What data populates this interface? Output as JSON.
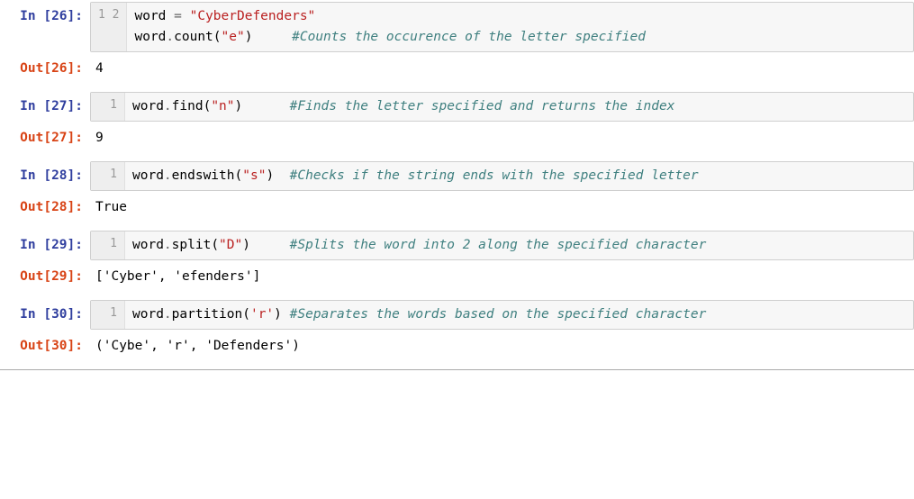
{
  "cells": [
    {
      "exec": 26,
      "lines": [
        [
          {
            "t": "var",
            "v": "word"
          },
          {
            "t": "txt",
            "v": " "
          },
          {
            "t": "op",
            "v": "="
          },
          {
            "t": "txt",
            "v": " "
          },
          {
            "t": "str",
            "v": "\"CyberDefenders\""
          }
        ],
        [
          {
            "t": "var",
            "v": "word"
          },
          {
            "t": "op",
            "v": "."
          },
          {
            "t": "call",
            "v": "count"
          },
          {
            "t": "paren",
            "v": "("
          },
          {
            "t": "str",
            "v": "\"e\""
          },
          {
            "t": "paren",
            "v": ")"
          },
          {
            "t": "txt",
            "v": "     "
          },
          {
            "t": "comment",
            "v": "#Counts the occurence of the letter specified"
          }
        ]
      ],
      "output": "4"
    },
    {
      "exec": 27,
      "lines": [
        [
          {
            "t": "var",
            "v": "word"
          },
          {
            "t": "op",
            "v": "."
          },
          {
            "t": "call",
            "v": "find"
          },
          {
            "t": "paren",
            "v": "("
          },
          {
            "t": "str",
            "v": "\"n\""
          },
          {
            "t": "paren",
            "v": ")"
          },
          {
            "t": "txt",
            "v": "      "
          },
          {
            "t": "comment",
            "v": "#Finds the letter specified and returns the index"
          }
        ]
      ],
      "output": "9"
    },
    {
      "exec": 28,
      "lines": [
        [
          {
            "t": "var",
            "v": "word"
          },
          {
            "t": "op",
            "v": "."
          },
          {
            "t": "call",
            "v": "endswith"
          },
          {
            "t": "paren",
            "v": "("
          },
          {
            "t": "str",
            "v": "\"s\""
          },
          {
            "t": "paren",
            "v": ")"
          },
          {
            "t": "txt",
            "v": "  "
          },
          {
            "t": "comment",
            "v": "#Checks if the string ends with the specified letter "
          }
        ]
      ],
      "output": "True"
    },
    {
      "exec": 29,
      "lines": [
        [
          {
            "t": "var",
            "v": "word"
          },
          {
            "t": "op",
            "v": "."
          },
          {
            "t": "call",
            "v": "split"
          },
          {
            "t": "paren",
            "v": "("
          },
          {
            "t": "str",
            "v": "\"D\""
          },
          {
            "t": "paren",
            "v": ")"
          },
          {
            "t": "txt",
            "v": "     "
          },
          {
            "t": "comment",
            "v": "#Splits the word into 2 along the specified character"
          }
        ]
      ],
      "output": "['Cyber', 'efenders']"
    },
    {
      "exec": 30,
      "lines": [
        [
          {
            "t": "var",
            "v": "word"
          },
          {
            "t": "op",
            "v": "."
          },
          {
            "t": "call",
            "v": "partition"
          },
          {
            "t": "paren",
            "v": "("
          },
          {
            "t": "str",
            "v": "'r'"
          },
          {
            "t": "paren",
            "v": ")"
          },
          {
            "t": "txt",
            "v": " "
          },
          {
            "t": "comment",
            "v": "#Separates the words based on the specified character"
          }
        ]
      ],
      "output": "('Cybe', 'r', 'Defenders')"
    }
  ],
  "labels": {
    "in_prefix": "In [",
    "out_prefix": "Out[",
    "suffix": "]:"
  }
}
